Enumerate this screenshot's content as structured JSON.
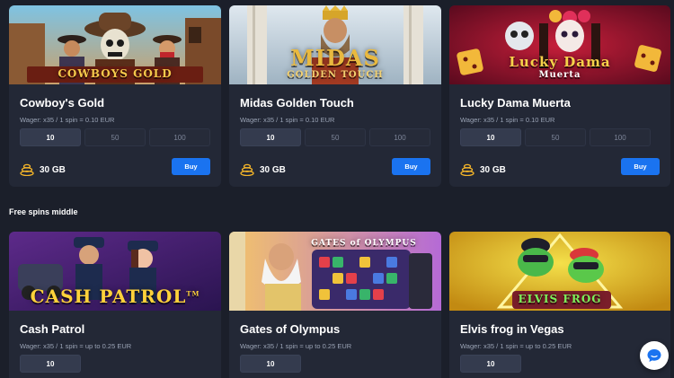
{
  "top_cards": [
    {
      "title": "Cowboy's Gold",
      "logo_text": "COWBOYS GOLD",
      "wager": "Wager: x35 / 1 spin = 0.10 EUR",
      "options": [
        "10",
        "50",
        "100"
      ],
      "selected": "10",
      "price": "30 GB",
      "buy_label": "Buy"
    },
    {
      "title": "Midas Golden Touch",
      "logo_text": "MIDAS",
      "logo_sub": "GOLDEN TOUCH",
      "wager": "Wager: x35 / 1 spin = 0.10 EUR",
      "options": [
        "10",
        "50",
        "100"
      ],
      "selected": "10",
      "price": "30 GB",
      "buy_label": "Buy"
    },
    {
      "title": "Lucky Dama Muerta",
      "logo_text": "Lucky Dama",
      "logo_sub": "Muerta",
      "wager": "Wager: x35 / 1 spin = 0.10 EUR",
      "options": [
        "10",
        "50",
        "100"
      ],
      "selected": "10",
      "price": "30 GB",
      "buy_label": "Buy"
    }
  ],
  "section_title": "Free spins middle",
  "bottom_cards": [
    {
      "title": "Cash Patrol",
      "logo_text": "CASH PATROL",
      "logo_tm": "TM",
      "wager": "Wager: x35 / 1 spin = up to 0.25 EUR",
      "selected": "10"
    },
    {
      "title": "Gates of Olympus",
      "logo_text": "GATES of OLYMPUS",
      "wager": "Wager: x35 / 1 spin = up to 0.25 EUR",
      "selected": "10"
    },
    {
      "title": "Elvis frog in Vegas",
      "logo_text": "ELVIS FROG",
      "wager": "Wager: x35 / 1 spin = up to 0.25 EUR",
      "selected": "10"
    }
  ],
  "colors": {
    "background": "#1b1f2a",
    "card": "#232836",
    "buy_button": "#1a73f0",
    "coin_icon": "#f5b62a"
  },
  "icons": {
    "price": "gold-coins-icon",
    "chat": "chat-bubble-icon"
  }
}
